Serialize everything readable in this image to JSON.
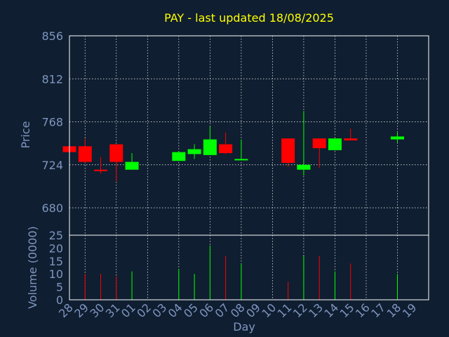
{
  "chart_data": {
    "type": "candlestick",
    "title": "PAY - last updated 18/08/2025",
    "ylabel": "Price",
    "volume_label": "Volume (0000)",
    "xlabel": "Day",
    "ylim": [
      652,
      856
    ],
    "y_ticks": [
      "856",
      "812",
      "768",
      "724",
      "680"
    ],
    "volume_ylim": [
      0,
      25
    ],
    "volume_ticks": [
      "25",
      "20",
      "15",
      "10",
      "5",
      "0"
    ],
    "x_ticks": [
      "28",
      "29",
      "30",
      "31",
      "01",
      "02",
      "03",
      "04",
      "05",
      "06",
      "07",
      "08",
      "09",
      "10",
      "11",
      "12",
      "13",
      "14",
      "15",
      "16",
      "17",
      "18",
      "19"
    ],
    "grid": true,
    "colors": {
      "up": "#00ff00",
      "down": "#ff0000",
      "title": "#ffff00",
      "axis": "#7f95c0",
      "background": "#0f1e30"
    },
    "candles": [
      {
        "day": "28",
        "open": 743,
        "high": 748,
        "low": 736,
        "close": 737,
        "volume": 0
      },
      {
        "day": "29",
        "open": 743,
        "high": 751,
        "low": 726,
        "close": 727,
        "volume": 10
      },
      {
        "day": "30",
        "open": 719,
        "high": 732,
        "low": 715,
        "close": 718,
        "volume": 10
      },
      {
        "day": "31",
        "open": 745,
        "high": 745,
        "low": 707,
        "close": 727,
        "volume": 9
      },
      {
        "day": "01",
        "open": 719,
        "high": 736,
        "low": 719,
        "close": 727,
        "volume": 11
      },
      {
        "day": "04",
        "open": 728,
        "high": 738,
        "low": 728,
        "close": 737,
        "volume": 12
      },
      {
        "day": "05",
        "open": 735,
        "high": 745,
        "low": 730,
        "close": 740,
        "volume": 10
      },
      {
        "day": "06",
        "open": 734,
        "high": 763,
        "low": 734,
        "close": 750,
        "volume": 21
      },
      {
        "day": "07",
        "open": 745,
        "high": 757,
        "low": 735,
        "close": 736,
        "volume": 17
      },
      {
        "day": "08",
        "open": 729,
        "high": 750,
        "low": 729,
        "close": 730,
        "volume": 14
      },
      {
        "day": "11",
        "open": 751,
        "high": 751,
        "low": 722,
        "close": 726,
        "volume": 7
      },
      {
        "day": "12",
        "open": 719,
        "high": 779,
        "low": 713,
        "close": 724,
        "volume": 17
      },
      {
        "day": "13",
        "open": 751,
        "high": 751,
        "low": 721,
        "close": 741,
        "volume": 17
      },
      {
        "day": "14",
        "open": 739,
        "high": 751,
        "low": 739,
        "close": 751,
        "volume": 11
      },
      {
        "day": "15",
        "open": 751,
        "high": 761,
        "low": 751,
        "close": 749,
        "volume": 14
      },
      {
        "day": "18",
        "open": 750,
        "high": 757,
        "low": 747,
        "close": 753,
        "volume": 10
      }
    ]
  }
}
